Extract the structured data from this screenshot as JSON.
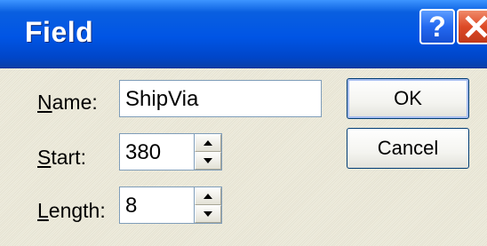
{
  "dialog": {
    "title": "Field",
    "help_glyph": "?",
    "close_icon": "close-icon"
  },
  "form": {
    "name_mnemonic": "N",
    "name_rest": "ame:",
    "name_value": "ShipVia",
    "start_mnemonic": "S",
    "start_rest": "tart:",
    "start_value": "380",
    "length_mnemonic": "L",
    "length_rest": "ength:",
    "length_value": "8"
  },
  "buttons": {
    "ok_label": "OK",
    "cancel_label": "Cancel"
  },
  "colors": {
    "titlebar": "#0055e5",
    "window_face": "#ece9d8",
    "close_button": "#dd4a26",
    "field_border": "#7f9db9"
  }
}
